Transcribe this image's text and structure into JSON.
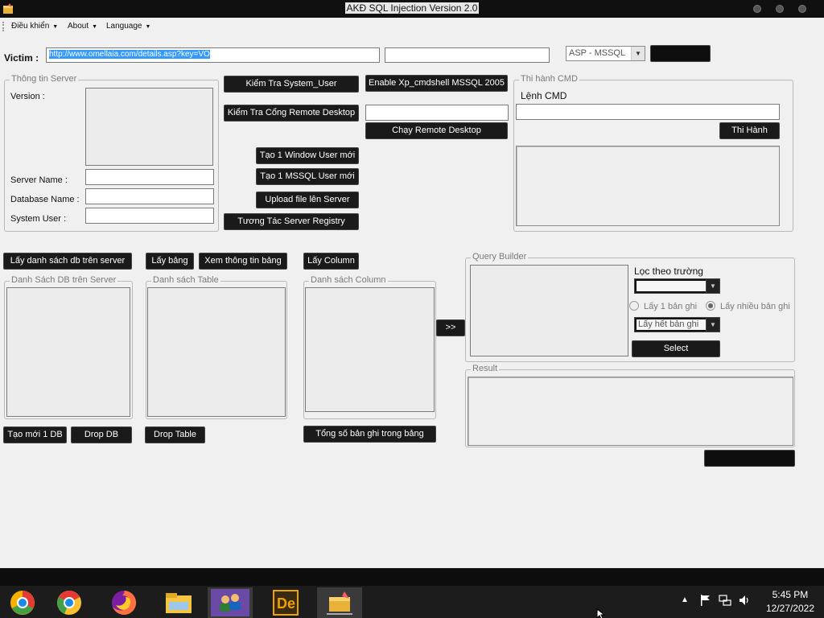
{
  "window": {
    "title": "AKĐ SQL Injection Version 2.0"
  },
  "menu": {
    "items": [
      "Điều khiển",
      "About",
      "Language"
    ]
  },
  "victim": {
    "label": "Victim :",
    "url_value": "http://www.omellaia.com/details.asp?key=VO",
    "extra_value": "",
    "db_type": "ASP - MSSQL",
    "go_label": ""
  },
  "server_info": {
    "legend": "Thông tin Server",
    "version_label": "Version :",
    "server_name_label": "Server Name :",
    "database_name_label": "Database Name :",
    "system_user_label": "System User :"
  },
  "actions": {
    "check_system_user": "Kiểm Tra System_User",
    "check_remote_port": "Kiểm Tra Cổng Remote Desktop",
    "enable_xp": "Enable Xp_cmdshell MSSQL 2005",
    "run_remote": "Chạy Remote Desktop",
    "create_windows_user": "Tạo 1 Window User mới",
    "create_mssql_user": "Tạo 1 MSSQL User mới",
    "upload_file": "Upload file lên Server",
    "registry": "Tương Tác Server Registry"
  },
  "cmd": {
    "legend": "Thi hành CMD",
    "label": "Lệnh CMD",
    "execute": "Thi Hành"
  },
  "db": {
    "get_db_list": "Lấy danh sách db trên server",
    "db_list_legend": "Danh Sách DB trên Server",
    "create_db": "Tạo mới 1 DB",
    "drop_db": "Drop DB",
    "get_tables": "Lấy bảng",
    "view_table_info": "Xem thông tin bảng",
    "table_list_legend": "Danh sách Table",
    "drop_table": "Drop Table",
    "get_columns": "Lấy Column",
    "column_list_legend": "Danh sách Column",
    "total_records": "Tổng số bản ghi trong bảng",
    "move_button": ">>"
  },
  "query_builder": {
    "legend": "Query Builder",
    "filter_label": "Lọc theo trường",
    "get_one": "Lấy 1 bản ghi",
    "get_many": "Lấy nhiều bản ghi",
    "get_all": "Lấy hết bản ghi",
    "select": "Select"
  },
  "result": {
    "legend": "Result",
    "bottom_button": ""
  },
  "taskbar": {
    "time": "5:45 PM",
    "date": "12/27/2022",
    "icons": [
      "chrome-canary-icon",
      "chrome-icon",
      "firefox-icon",
      "file-explorer-icon",
      "users-icon",
      "dreamweaver-icon",
      "sql-injection-app-icon"
    ]
  },
  "colors": {
    "button_bg": "#1a1a1a",
    "selection": "#3399ff",
    "window_bg": "#f0f0f0"
  }
}
